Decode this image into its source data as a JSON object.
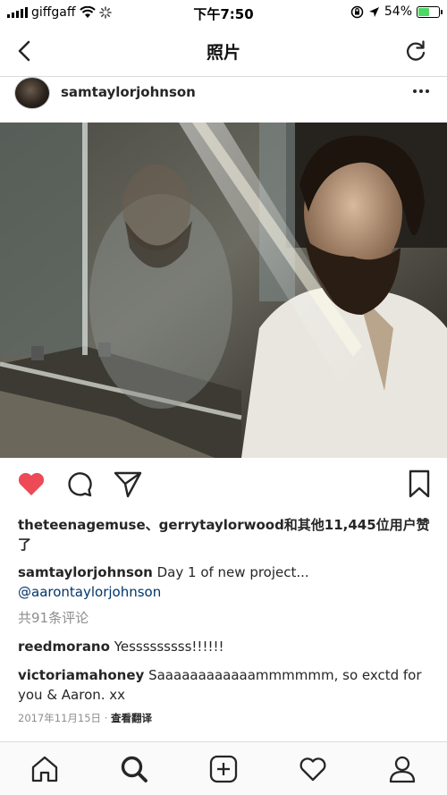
{
  "status": {
    "carrier": "giffgaff",
    "time": "下午7:50",
    "battery": "54%",
    "battery_level": 0.54,
    "battery_color": "#4cd964"
  },
  "nav": {
    "title": "照片",
    "back_icon": "chevron-left-icon",
    "refresh_icon": "refresh-icon"
  },
  "post": {
    "username": "samtaylorjohnson",
    "likes_text": "theteenagemuse、gerrytaylorwood和其他11,445位用户赞了",
    "caption_user": "samtaylorjohnson",
    "caption_text": " Day 1 of new project... ",
    "caption_mention": "@aarontaylorjohnson",
    "view_comments": "共91条评论",
    "comments": [
      {
        "user": "reedmorano",
        "text": " Yesssssssss!!!!!!"
      },
      {
        "user": "victoriamahoney",
        "text": " Saaaaaaaaaaaammmmmm, so exctd for you & Aaron. xx"
      }
    ],
    "date": "2017年11月15日",
    "separator": " · ",
    "translate": "查看翻译",
    "liked": true,
    "heart_color": "#ed4956"
  },
  "tabs": [
    "home-icon",
    "search-icon",
    "add-icon",
    "activity-heart-icon",
    "profile-icon"
  ]
}
